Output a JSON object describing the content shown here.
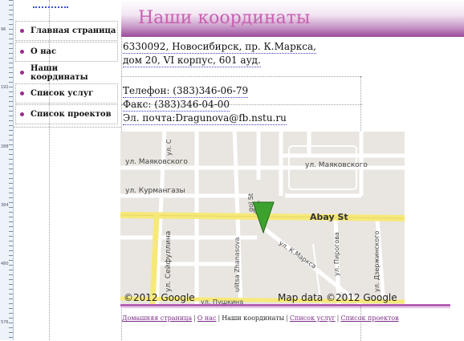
{
  "ruler": {
    "marks": [
      "96",
      "192",
      "288",
      "384",
      "480",
      "576"
    ]
  },
  "nav": {
    "items": [
      {
        "label": "Главная страница"
      },
      {
        "label": "О нас"
      },
      {
        "label": "Наши координаты"
      },
      {
        "label": "Список услуг"
      },
      {
        "label": "Список проектов"
      }
    ]
  },
  "page": {
    "title": "Наши координаты"
  },
  "address": {
    "line1": "6330092, Новосибирск, пр. К.Маркса,",
    "line2": "дом 20, VI корпус, 601 ауд."
  },
  "contacts": {
    "phone": "Телефон: (383)346-06-79",
    "fax": "Факс: (383)346-04-00",
    "email": "Эл. почта:Dragunova@fb.nstu.ru"
  },
  "map": {
    "streets": {
      "mayakovskogo_left": "ул. Маяковского",
      "mayakovskogo_right": "ул. Маяковского",
      "kurmangazy": "ул. Курмангазы",
      "abay": "Abay St",
      "seifullina": "ул. Сейфуллина",
      "zhansova": "ulitsa Zhanasova",
      "kmarksa": "ул. К.Маркса",
      "pirogova": "ул. Пирогова",
      "dzerzhinskogo": "ул. Дзержинского",
      "gogol": "gol St",
      "small_top": "ул. С"
    },
    "copyright": "©2012 Google",
    "mapdata": "Map data ©2012 Google",
    "bottom_street": "ул. Пушкина",
    "colors": {
      "road": "#ffffff",
      "main_road": "#f6e97a",
      "background": "#e9e6e1",
      "marker": "#3da12f"
    }
  },
  "footer": {
    "links": [
      {
        "label": "Домашняя страница"
      },
      {
        "label": "О нас"
      },
      {
        "label": "Наши координаты"
      },
      {
        "label": "Список услуг"
      },
      {
        "label": "Список проектов"
      }
    ],
    "separator": "|"
  },
  "colors": {
    "accent": "#9b2d8f",
    "title": "#c85fb1",
    "link": "#7b2d86"
  }
}
